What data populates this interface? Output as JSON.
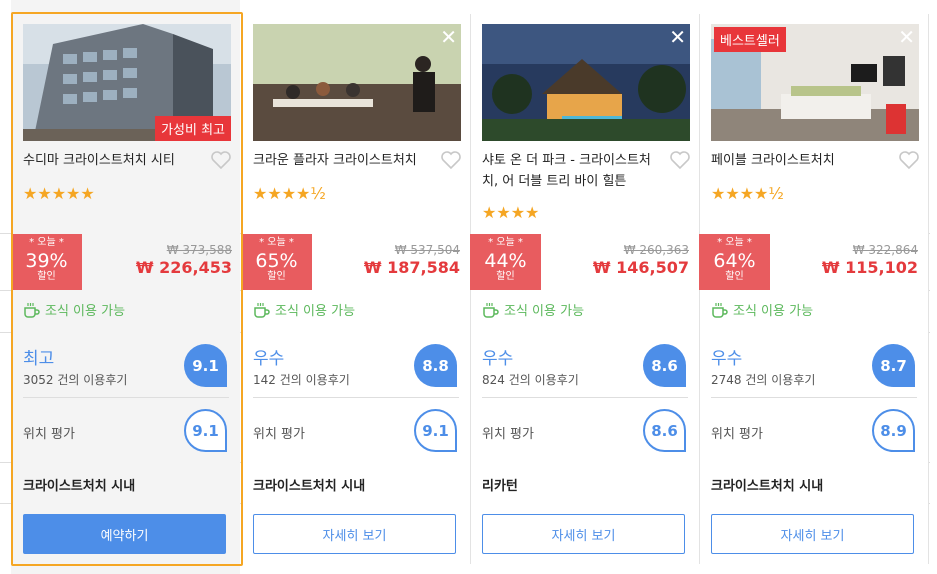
{
  "colors": {
    "accent": "#4d8ee8",
    "deal": "#e85c5f",
    "price": "#e43a3d",
    "selected_border": "#f5a623",
    "breakfast": "#5cb85c"
  },
  "breakfast_label": "조식 이용 가능",
  "location_label": "위치 평가",
  "hotels": [
    {
      "name": "수디마 크라이스트처치 시티",
      "photo_badge": "가성비 최고",
      "stars": "★★★★★",
      "deal_top": "* 오늘 *",
      "discount": "39%",
      "deal_bottom": "할인",
      "original_price": "₩ 373,588",
      "price": "₩ 226,453",
      "rating_label": "최고",
      "review_count": "3052 건의 이용후기",
      "score": "9.1",
      "location_score": "9.1",
      "area": "크라이스트처치 시내",
      "button": "예약하기"
    },
    {
      "name": "크라운 플라자 크라이스트처치",
      "stars": "★★★★½",
      "deal_top": "* 오늘 *",
      "discount": "65%",
      "deal_bottom": "할인",
      "original_price": "₩ 537,504",
      "price": "₩ 187,584",
      "rating_label": "우수",
      "review_count": "142 건의 이용후기",
      "score": "8.8",
      "location_score": "9.1",
      "area": "크라이스트처치 시내",
      "button": "자세히 보기"
    },
    {
      "name": "샤토 온 더 파크 - 크라이스트처치, 어 더블 트리 바이 힐튼",
      "stars": "★★★★",
      "deal_top": "* 오늘 *",
      "discount": "44%",
      "deal_bottom": "할인",
      "original_price": "₩ 260,363",
      "price": "₩ 146,507",
      "rating_label": "우수",
      "review_count": "824 건의 이용후기",
      "score": "8.6",
      "location_score": "8.6",
      "area": "리카턴",
      "button": "자세히 보기"
    },
    {
      "name": "페이블 크라이스트처치",
      "photo_badge": "베스트셀러",
      "stars": "★★★★½",
      "deal_top": "* 오늘 *",
      "discount": "64%",
      "deal_bottom": "할인",
      "original_price": "₩ 322,864",
      "price": "₩ 115,102",
      "rating_label": "우수",
      "review_count": "2748 건의 이용후기",
      "score": "8.7",
      "location_score": "8.9",
      "area": "크라이스트처치 시내",
      "button": "자세히 보기"
    }
  ]
}
